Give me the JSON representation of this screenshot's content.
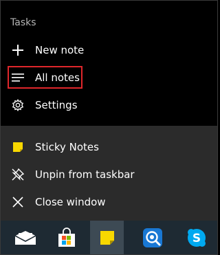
{
  "tasks": {
    "heading": "Tasks",
    "items": [
      {
        "label": "New note",
        "icon": "plus-icon"
      },
      {
        "label": "All notes",
        "icon": "list-icon"
      },
      {
        "label": "Settings",
        "icon": "gear-icon"
      }
    ]
  },
  "app_actions": {
    "items": [
      {
        "label": "Sticky Notes",
        "icon": "sticky-notes-icon"
      },
      {
        "label": "Unpin from taskbar",
        "icon": "unpin-icon"
      },
      {
        "label": "Close window",
        "icon": "close-icon"
      }
    ]
  },
  "taskbar": {
    "icons": [
      {
        "name": "mail-icon"
      },
      {
        "name": "store-icon"
      },
      {
        "name": "sticky-notes-icon",
        "active": true
      },
      {
        "name": "magnifier-icon"
      },
      {
        "name": "skype-icon"
      }
    ]
  },
  "colors": {
    "highlight_border": "#e0262b",
    "sticky_yellow": "#f8d800",
    "skype_blue": "#00a9f0"
  }
}
